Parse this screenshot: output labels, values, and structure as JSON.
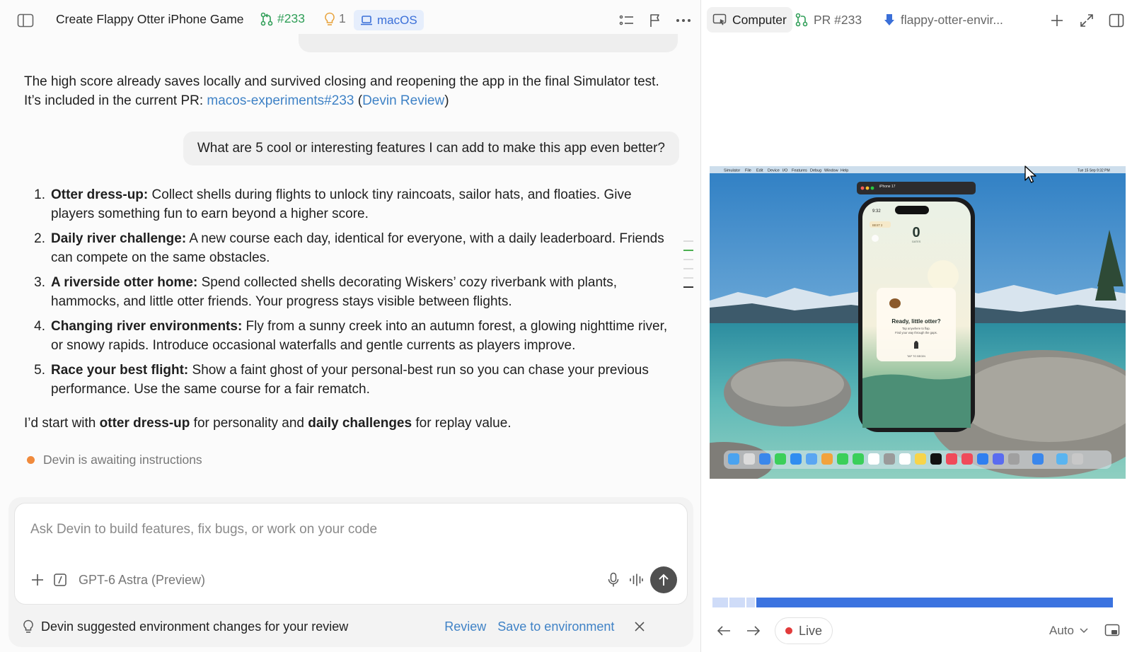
{
  "header": {
    "title": "Create Flappy Otter iPhone Game",
    "pr_number": "#233",
    "hint_count": "1",
    "environment": "macOS"
  },
  "chat": {
    "assistant_intro": {
      "text_before": "The high score already saves locally and survived closing and reopening the app in the final Simulator test. It’s included in the current PR:",
      "pr_link": "macos-experiments#233",
      "paren_open": "(",
      "review_link": "Devin Review",
      "paren_close": ")"
    },
    "user_message": "What are 5 cool or interesting features I can add to make this app even better?",
    "features": [
      {
        "num": "1.",
        "title": "Otter dress-up:",
        "body": " Collect shells during flights to unlock tiny raincoats, sailor hats, and floaties. Give players something fun to earn beyond a higher score."
      },
      {
        "num": "2.",
        "title": "Daily river challenge:",
        "body": " A new course each day, identical for everyone, with a daily leaderboard. Friends can compete on the same obstacles."
      },
      {
        "num": "3.",
        "title": "A riverside otter home:",
        "body": " Spend collected shells decorating Wiskers’ cozy riverbank with plants, hammocks, and little otter friends. Your progress stays visible between flights."
      },
      {
        "num": "4.",
        "title": "Changing river environments:",
        "body": " Fly from a sunny creek into an autumn forest, a glowing nighttime river, or snowy rapids. Introduce occasional waterfalls and gentle currents as players improve."
      },
      {
        "num": "5.",
        "title": "Race your best flight:",
        "body": " Show a faint ghost of your personal-best run so you can chase your previous performance. Use the same course for a fair rematch."
      }
    ],
    "closing": {
      "p1": "I’d start with ",
      "b1": "otter dress-up",
      "p2": " for personality and ",
      "b2": "daily challenges",
      "p3": " for replay value."
    },
    "status": "Devin is awaiting instructions"
  },
  "composer": {
    "placeholder": "Ask Devin to build features, fix bugs, or work on your code",
    "model": "GPT-6 Astra (Preview)"
  },
  "suggestion": {
    "text": "Devin suggested environment changes for your review",
    "review": "Review",
    "save": "Save to environment"
  },
  "right_panel": {
    "tabs": [
      {
        "label": "Computer"
      },
      {
        "label": "PR #233"
      },
      {
        "label": "flappy-otter-envir..."
      }
    ],
    "live_label": "Live",
    "quality": "Auto",
    "progress": 0.975
  },
  "simulator": {
    "menubar": [
      "Simulator",
      "File",
      "Edit",
      "Device",
      "I/O",
      "Features",
      "Debug",
      "Window",
      "Help"
    ],
    "clock": "Tue 15 Sep 9:32 PM",
    "device_name": "iPhone 17",
    "phone_time": "9:32",
    "best_label": "BEST 2",
    "score": "0",
    "score_label": "GATES",
    "headline": "Ready, little otter?",
    "sub1": "Tap anywhere to flap.",
    "sub2": "Find your way through the gaps.",
    "tap_label": "TAP TO BEGIN"
  },
  "colors": {
    "link": "#3f82c6",
    "pr_green": "#2f9e57",
    "env_chip_bg": "#e6eefc",
    "progress_blue": "#3b73e0",
    "status_dot": "#f08a3c",
    "live_red": "#e23b3b"
  }
}
